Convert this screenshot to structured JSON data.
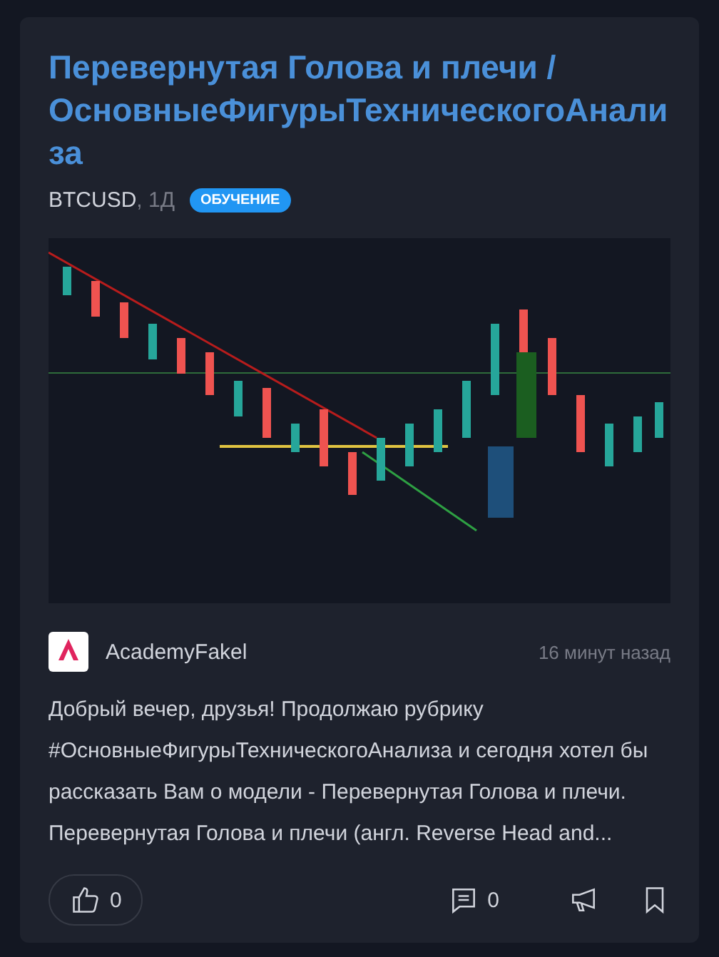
{
  "post": {
    "title": "Перевернутая Голова и плечи / ОсновныеФигурыТехническогоАнализа",
    "symbol": "BTCUSD",
    "interval": ", 1Д",
    "tag": "ОБУЧЕНИЕ",
    "author": "AcademyFakel",
    "time": "16 минут назад",
    "text": "Добрый вечер, друзья! Продолжаю рубрику #ОсновныеФигурыТехническогоАнализа и сегодня хотел бы рассказать Вам о модели - Перевернутая Голова и плечи. Перевернутая Голова и плечи (англ. Reverse Head and...",
    "likes": "0",
    "comments": "0"
  }
}
